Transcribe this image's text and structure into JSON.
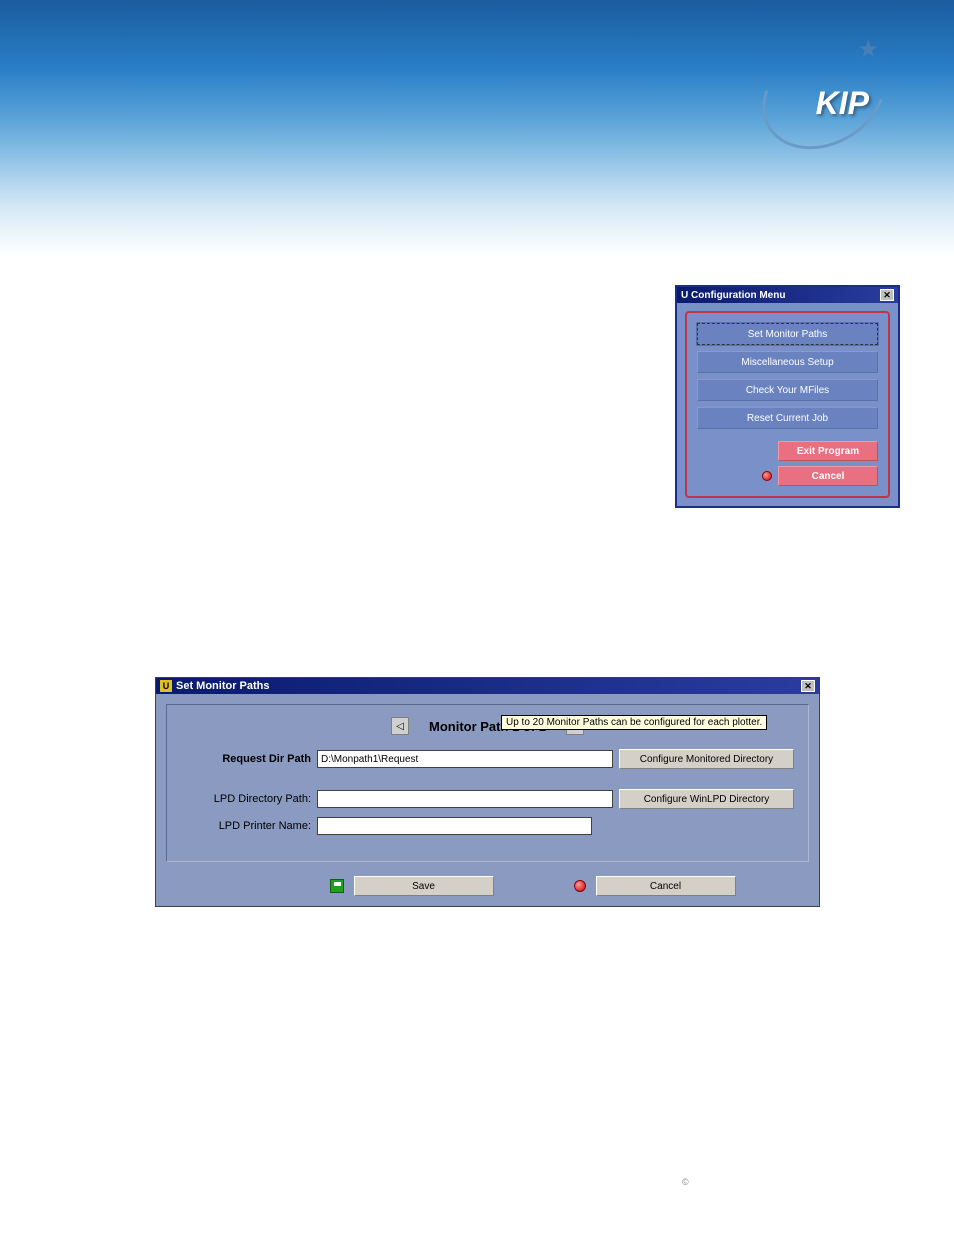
{
  "logo": {
    "text": "KIP"
  },
  "copyright_symbol": "©",
  "config_menu": {
    "title": "Configuration Menu",
    "buttons": {
      "set_monitor_paths": "Set Monitor Paths",
      "misc_setup": "Miscellaneous Setup",
      "check_mfiles": "Check Your MFiles",
      "reset_job": "Reset Current Job",
      "exit_program": "Exit Program",
      "cancel": "Cancel"
    }
  },
  "monitor_paths": {
    "title": "Set Monitor Paths",
    "nav_label": "Monitor Path 1 of 1",
    "tooltip": "Up to 20 Monitor Paths can be configured for each plotter.",
    "fields": {
      "request_dir_label": "Request Dir Path",
      "request_dir_value": "D:\\Monpath1\\Request",
      "lpd_dir_label": "LPD Directory Path:",
      "lpd_dir_value": "",
      "lpd_printer_label": "LPD Printer Name:",
      "lpd_printer_value": ""
    },
    "buttons": {
      "config_monitored": "Configure Monitored Directory",
      "config_winlpd": "Configure WinLPD Directory",
      "save": "Save",
      "cancel": "Cancel"
    }
  }
}
